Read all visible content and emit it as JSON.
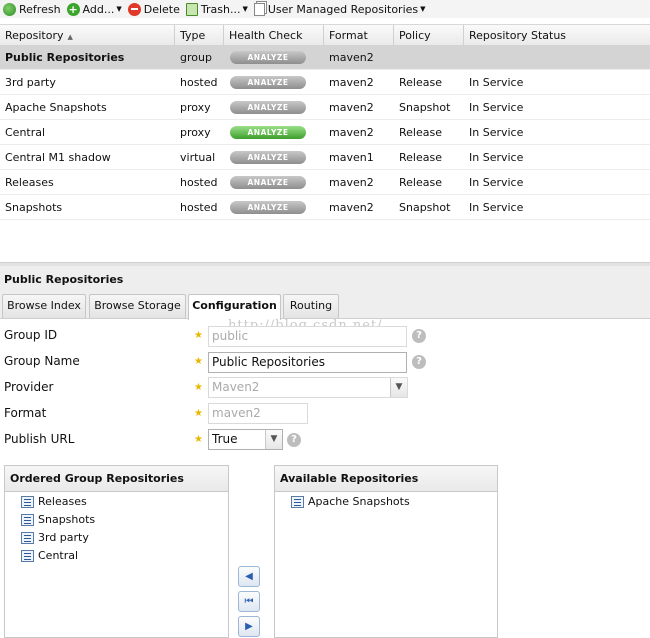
{
  "toolbar": {
    "refresh": "Refresh",
    "add": "Add...",
    "delete": "Delete",
    "trash": "Trash...",
    "view": "User Managed Repositories"
  },
  "grid": {
    "headers": [
      "Repository",
      "Type",
      "Health Check",
      "Format",
      "Policy",
      "Repository Status"
    ],
    "rows": [
      {
        "name": "Public Repositories",
        "type": "group",
        "health": "ANALYZE",
        "format": "maven2",
        "policy": "",
        "status": ""
      },
      {
        "name": "3rd party",
        "type": "hosted",
        "health": "ANALYZE",
        "format": "maven2",
        "policy": "Release",
        "status": "In Service"
      },
      {
        "name": "Apache Snapshots",
        "type": "proxy",
        "health": "ANALYZE",
        "format": "maven2",
        "policy": "Snapshot",
        "status": "In Service"
      },
      {
        "name": "Central",
        "type": "proxy",
        "health": "ANALYZE",
        "format": "maven2",
        "policy": "Release",
        "status": "In Service"
      },
      {
        "name": "Central M1 shadow",
        "type": "virtual",
        "health": "ANALYZE",
        "format": "maven1",
        "policy": "Release",
        "status": "In Service"
      },
      {
        "name": "Releases",
        "type": "hosted",
        "health": "ANALYZE",
        "format": "maven2",
        "policy": "Release",
        "status": "In Service"
      },
      {
        "name": "Snapshots",
        "type": "hosted",
        "health": "ANALYZE",
        "format": "maven2",
        "policy": "Snapshot",
        "status": "In Service"
      }
    ],
    "selected_row": 0,
    "highlighted_health_row": 3
  },
  "panel": {
    "title": "Public Repositories",
    "tabs": [
      "Browse Index",
      "Browse Storage",
      "Configuration",
      "Routing"
    ],
    "active_tab": 2
  },
  "form": {
    "group_id_label": "Group ID",
    "group_id_value": "public",
    "group_name_label": "Group Name",
    "group_name_value": "Public Repositories",
    "provider_label": "Provider",
    "provider_value": "Maven2",
    "format_label": "Format",
    "format_value": "maven2",
    "publish_url_label": "Publish URL",
    "publish_url_value": "True",
    "help": "?"
  },
  "watermark": "http://blog.csdn.net/",
  "ordered": {
    "title": "Ordered Group Repositories",
    "items": [
      "Releases",
      "Snapshots",
      "3rd party",
      "Central"
    ]
  },
  "available": {
    "title": "Available Repositories",
    "items": [
      "Apache Snapshots"
    ]
  },
  "move_buttons": [
    "◀",
    "⏮",
    "▶"
  ],
  "colors": {
    "selected_row": "#d4d4d4",
    "analyze_gray": "#a8a8a8",
    "analyze_green": "#5cbf45",
    "required_star": "#e8b800"
  }
}
